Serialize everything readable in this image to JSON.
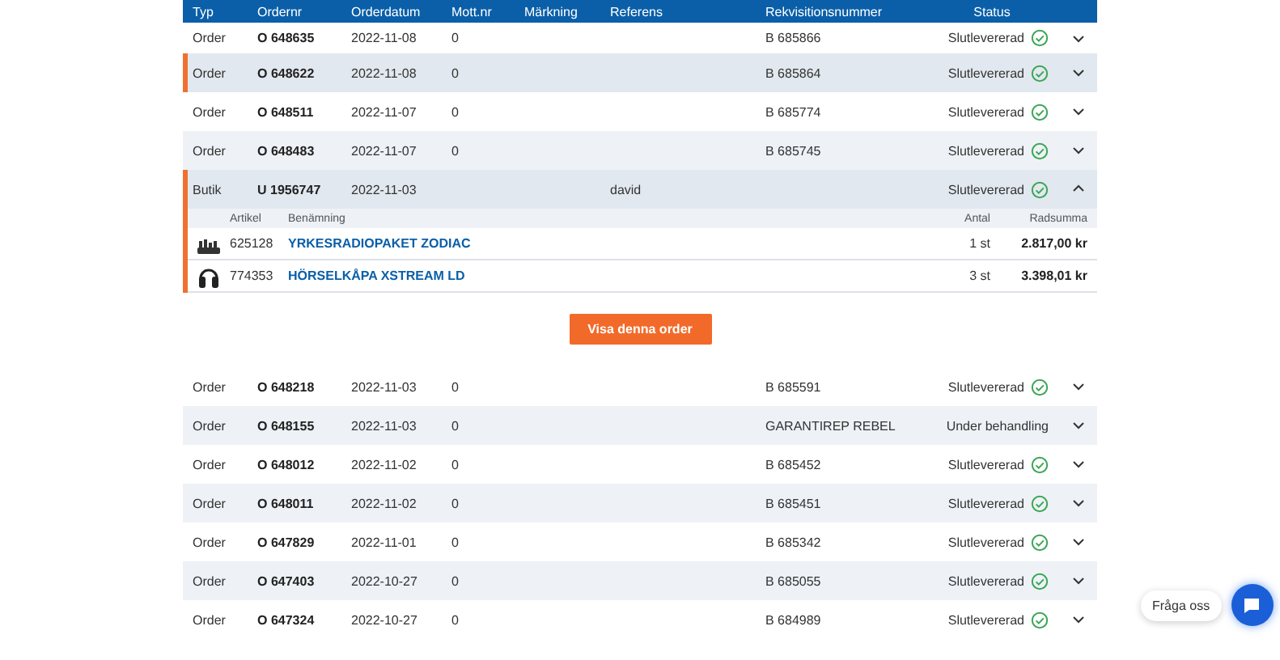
{
  "table": {
    "columns": [
      "Typ",
      "Ordernr",
      "Orderdatum",
      "Mott.nr",
      "Märkning",
      "Referens",
      "Rekvisitionsnummer",
      "Status"
    ],
    "rows": [
      {
        "type": "Order",
        "order_no": "O 648635",
        "date": "2022-11-08",
        "mott_nr": "0",
        "requisition": "B 685866",
        "status": "Slutlevererad",
        "kind": "delivered",
        "expanded": false,
        "highlighted": false
      },
      {
        "type": "Order",
        "order_no": "O 648622",
        "date": "2022-11-08",
        "mott_nr": "0",
        "requisition": "B 685864",
        "status": "Slutlevererad",
        "kind": "delivered",
        "expanded": false,
        "highlighted": true
      },
      {
        "type": "Order",
        "order_no": "O 648511",
        "date": "2022-11-07",
        "mott_nr": "0",
        "requisition": "B 685774",
        "status": "Slutlevererad",
        "kind": "delivered",
        "expanded": false,
        "highlighted": false
      },
      {
        "type": "Order",
        "order_no": "O 648483",
        "date": "2022-11-07",
        "mott_nr": "0",
        "requisition": "B 685745",
        "status": "Slutlevererad",
        "kind": "delivered",
        "expanded": false,
        "highlighted": false
      },
      {
        "type": "Butik",
        "order_no": "U 1956747",
        "date": "2022-11-03",
        "reference": "david",
        "status": "Slutlevererad",
        "kind": "delivered",
        "expanded": true,
        "highlighted": true,
        "details": {
          "columns": [
            "Artikel",
            "Benämning",
            "Antal",
            "Radsumma"
          ],
          "items": [
            {
              "kind": "radio",
              "article": "625128",
              "name": "YRKESRADIOPAKET ZODIAC",
              "quantity": "1 st",
              "sum": "2.817,00 kr"
            },
            {
              "kind": "headset",
              "article": "774353",
              "name": "HÖRSELKÅPA XSTREAM LD",
              "quantity": "3 st",
              "sum": "3.398,01 kr"
            }
          ],
          "button": "Visa denna order"
        }
      },
      {
        "type": "Order",
        "order_no": "O 648218",
        "date": "2022-11-03",
        "mott_nr": "0",
        "requisition": "B 685591",
        "status": "Slutlevererad",
        "kind": "delivered",
        "expanded": false,
        "highlighted": false
      },
      {
        "type": "Order",
        "order_no": "O 648155",
        "date": "2022-11-03",
        "mott_nr": "0",
        "requisition": "GARANTIREP REBEL",
        "status": "Under behandling",
        "kind": "processing",
        "expanded": false,
        "highlighted": false
      },
      {
        "type": "Order",
        "order_no": "O 648012",
        "date": "2022-11-02",
        "mott_nr": "0",
        "requisition": "B 685452",
        "status": "Slutlevererad",
        "kind": "delivered",
        "expanded": false,
        "highlighted": false
      },
      {
        "type": "Order",
        "order_no": "O 648011",
        "date": "2022-11-02",
        "mott_nr": "0",
        "requisition": "B 685451",
        "status": "Slutlevererad",
        "kind": "delivered",
        "expanded": false,
        "highlighted": false
      },
      {
        "type": "Order",
        "order_no": "O 647829",
        "date": "2022-11-01",
        "mott_nr": "0",
        "requisition": "B 685342",
        "status": "Slutlevererad",
        "kind": "delivered",
        "expanded": false,
        "highlighted": false
      },
      {
        "type": "Order",
        "order_no": "O 647403",
        "date": "2022-10-27",
        "mott_nr": "0",
        "requisition": "B 685055",
        "status": "Slutlevererad",
        "kind": "delivered",
        "expanded": false,
        "highlighted": false
      },
      {
        "type": "Order",
        "order_no": "O 647324",
        "date": "2022-10-27",
        "mott_nr": "0",
        "requisition": "B 684989",
        "status": "Slutlevererad",
        "kind": "delivered",
        "expanded": false,
        "highlighted": false
      }
    ]
  },
  "chat": {
    "label": "Fråga oss"
  }
}
